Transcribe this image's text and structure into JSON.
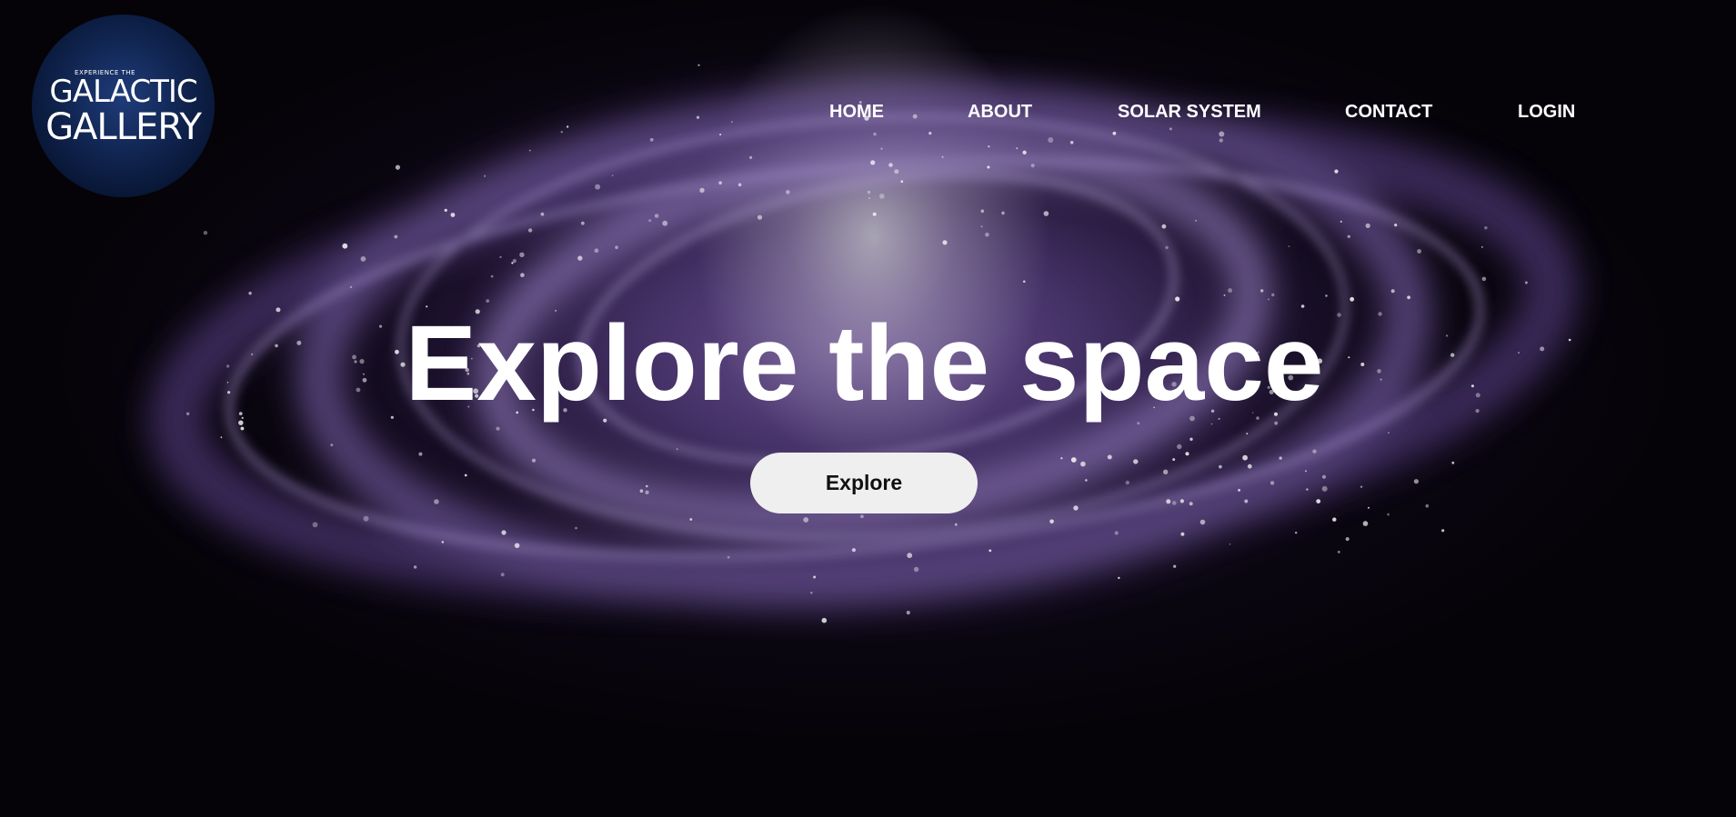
{
  "logo": {
    "prefix": "EXPERIENCE THE",
    "line1": "GALACTIC",
    "line2": "GALLERY"
  },
  "nav": {
    "items": [
      {
        "label": "HOME"
      },
      {
        "label": "ABOUT"
      },
      {
        "label": "SOLAR SYSTEM"
      },
      {
        "label": "CONTACT"
      },
      {
        "label": "LOGIN"
      }
    ]
  },
  "hero": {
    "headline": "Explore the space",
    "button_label": "Explore"
  },
  "colors": {
    "background": "#050308",
    "galaxy_purple": "#765ca0",
    "text": "#ffffff",
    "button_bg": "#efefef",
    "button_text": "#111111",
    "logo_bg": "#10244f"
  }
}
